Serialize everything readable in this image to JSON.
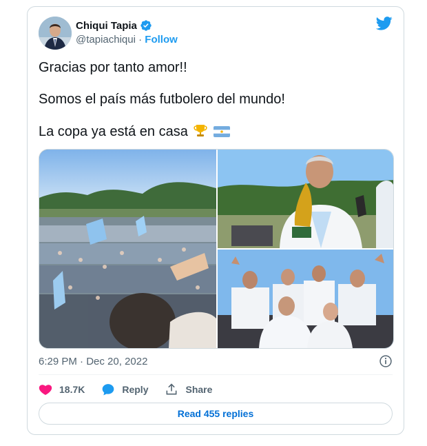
{
  "author": {
    "name": "Chiqui Tapia",
    "handle": "@tapiachiqui",
    "separator": " · ",
    "follow_label": "Follow"
  },
  "tweet": {
    "line1": "Gracias por tanto amor!!",
    "line2": "Somos el país más futbolero del mundo!",
    "line3": "La copa ya está en casa"
  },
  "timestamp": "6:29 PM · Dec 20, 2022",
  "actions": {
    "likes": "18.7K",
    "reply_label": "Reply",
    "share_label": "Share"
  },
  "read_replies_label": "Read 455 replies",
  "colors": {
    "accent": "#1d9bf0",
    "like": "#f91880",
    "muted": "#536471",
    "border": "#cfd9de"
  },
  "icons": [
    "verified-badge-icon",
    "twitter-bird-icon",
    "trophy-icon",
    "argentina-flag-icon",
    "info-icon",
    "heart-icon",
    "reply-icon",
    "share-icon"
  ]
}
